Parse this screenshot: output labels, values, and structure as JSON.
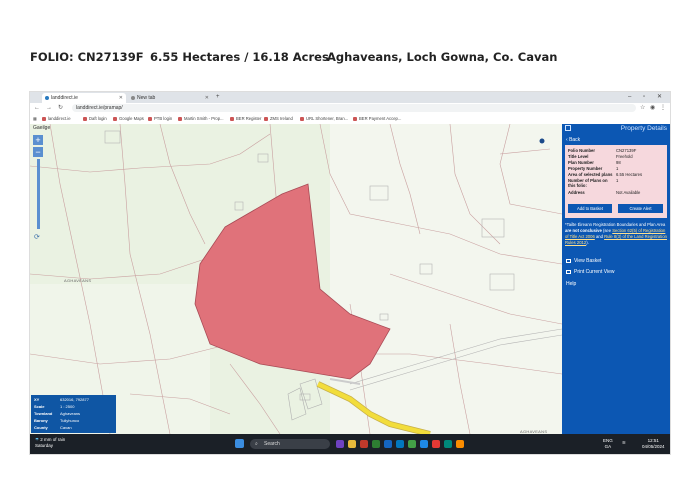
{
  "header": {
    "folio": "FOLIO: CN27139F",
    "area": "6.55 Hectares / 16.18 Acres",
    "location": "Aghaveans, Loch Gowna, Co. Cavan"
  },
  "browser": {
    "tabs": [
      {
        "label": "landdirect.ie"
      },
      {
        "label": "New tab"
      }
    ],
    "new_tab": "+",
    "url": "landdirect.ie/pramap/",
    "bookmarks": [
      "landdirect.ie",
      "Daft login",
      "Google Maps",
      "PTB login",
      "Martin Smith - Prop...",
      "BER Register",
      "ZMS Ireland",
      "URL Shortener, Bran...",
      "BER Payment Accep..."
    ]
  },
  "map": {
    "gaeilge": "Gaeilge",
    "zoom_in": "+",
    "zoom_out": "−",
    "townlands": [
      "AGHAVEANS",
      "AGHAVEANS"
    ],
    "parcel_color": "#e0727a",
    "road_color": "#f2dd3b"
  },
  "infobox": {
    "rows": [
      {
        "k": "XY",
        "v": "632016, 792877"
      },
      {
        "k": "Scale",
        "v": "1 : 2500"
      },
      {
        "k": "Townland",
        "v": "Aghaveans"
      },
      {
        "k": "Barony",
        "v": "Tullyhunco"
      },
      {
        "k": "County",
        "v": "Cavan"
      }
    ]
  },
  "panel": {
    "title": "Property Details",
    "back": "Back",
    "details": [
      {
        "k": "Folio Number",
        "v": "CN27139F"
      },
      {
        "k": "Title Level",
        "v": "Freehold"
      },
      {
        "k": "Plan Number",
        "v": "98"
      },
      {
        "k": "Property Number",
        "v": "1"
      },
      {
        "k": "Area of selected plans",
        "v": "6.55 Hectares"
      },
      {
        "k": "Number of Plans on this folio:",
        "v": "1"
      },
      {
        "k": "Address",
        "v": "Not Available"
      }
    ],
    "add_basket": "Add to Basket",
    "create_alert": "Create Alert",
    "note_1": "*Tailte Éireann Registration Boundaries and Plan Area ",
    "note_bold": "are not conclusive",
    "note_2": " (see ",
    "note_link1": "Section 62(5) of Registration of Title Act 2006",
    "note_3": " and ",
    "note_link2": "Rule 8(3) of the Land Registration Rules 2012",
    "note_4": ").",
    "view_basket": "View Basket",
    "print_view": "Print Current View",
    "help": "Help"
  },
  "taskbar": {
    "weather_line1": "2 mm of rain",
    "weather_line2": "Saturday",
    "search": "Search",
    "lang1": "ENG",
    "lang2": "GA",
    "time": "12:51",
    "date": "04/05/2024"
  }
}
